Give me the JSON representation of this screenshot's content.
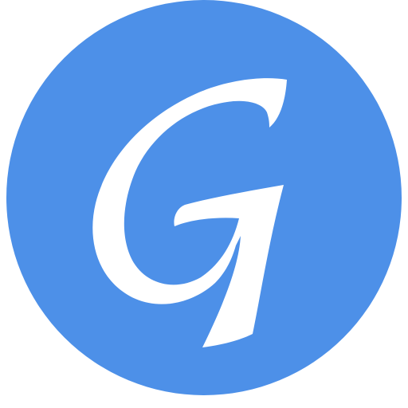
{
  "logo": {
    "letter": "G",
    "circle_color": "#4d90e8",
    "glyph_color": "#ffffff",
    "background_color": "#ffffff"
  }
}
